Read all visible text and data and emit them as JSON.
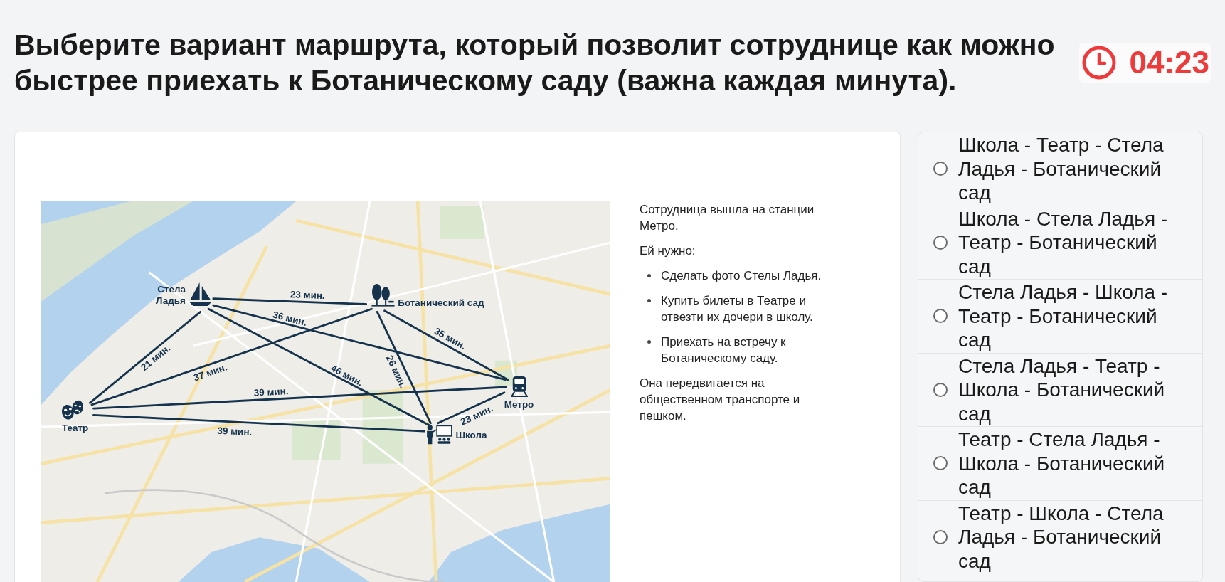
{
  "question": {
    "title": "Выберите вариант маршрута, который позволит сотруднице как можно быстрее приехать к Ботаническому саду (важна каждая минута)."
  },
  "timer": {
    "time": "04:23"
  },
  "map": {
    "places": [
      {
        "label": "Стела Ладья",
        "kind": "boat"
      },
      {
        "label": "Ботанический сад",
        "kind": "trees"
      },
      {
        "label": "Метро",
        "kind": "train"
      },
      {
        "label": "Театр",
        "kind": "masks"
      },
      {
        "label": "Школа",
        "kind": "teacher"
      }
    ],
    "routes": [
      {
        "time": "23 мин."
      },
      {
        "time": "36 мин."
      },
      {
        "time": "35 мин."
      },
      {
        "time": "21 мин."
      },
      {
        "time": "37 мин."
      },
      {
        "time": "46 мин."
      },
      {
        "time": "26 мин."
      },
      {
        "time": "39 мин."
      },
      {
        "time": "23 мин."
      },
      {
        "time": "39 мин."
      }
    ]
  },
  "description": {
    "intro": [
      "Сотрудница вышла на станции Метро.",
      "Ей нужно:"
    ],
    "tasks": [
      "Сделать фото Стелы Ладья.",
      "Купить билеты в Театре и отвезти их дочери в школу.",
      "Приехать на встречу к Ботаническому саду."
    ],
    "outro": [
      "Она передвигается на общественном транспорте и пешком."
    ]
  },
  "options": [
    {
      "label": "Школа - Театр - Стела Ладья - Ботанический сад",
      "selected": false
    },
    {
      "label": "Школа - Стела Ладья - Театр - Ботанический сад",
      "selected": false
    },
    {
      "label": "Стела Ладья - Школа - Театр - Ботанический сад",
      "selected": false
    },
    {
      "label": "Стела Ладья - Театр - Школа - Ботанический сад",
      "selected": false
    },
    {
      "label": "Театр - Стела Ладья - Школа - Ботанический сад",
      "selected": false
    },
    {
      "label": "Театр - Школа - Стела Ладья - Ботанический сад",
      "selected": false
    }
  ]
}
